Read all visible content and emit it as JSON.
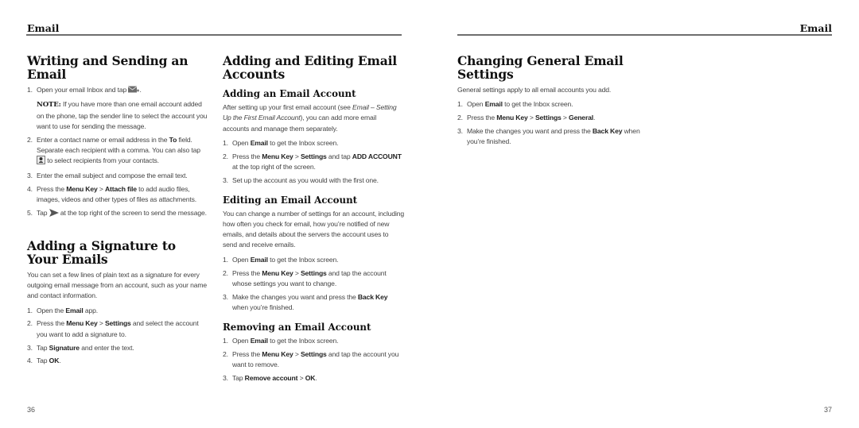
{
  "left_page": {
    "running_head": "Email",
    "page_number": "36",
    "col1": {
      "s1": {
        "title": "Writing and Sending an Email",
        "steps": [
          {
            "n": "1.",
            "a": "Open your email Inbox and tap",
            "b": "."
          },
          {
            "n": "2.",
            "a": "Enter a contact name or email address in the",
            "bold1": "To",
            "b": "field. Separate each recipient with a comma. You can also tap",
            "c": "to select recipients from your contacts."
          },
          {
            "n": "3.",
            "a": "Enter the email subject and compose the email text."
          },
          {
            "n": "4.",
            "a": "Press the",
            "bold1": "Menu Key",
            "sep": ">",
            "bold2": "Attach file",
            "b": "to add audio files, images, videos and other types of files as attachments."
          },
          {
            "n": "5.",
            "a": "Tap",
            "b": "at the top right of the screen to send the message."
          }
        ],
        "note_label": "NOTE:",
        "note_text": "If you have more than one email account added on the phone, tap the sender line to select the account you want to use for sending the message.",
        "icons": {
          "compose": "compose-email-icon",
          "contacts": "contacts-picker-icon",
          "send": "send-icon"
        }
      },
      "s2": {
        "title": "Adding a Signature to Your Emails",
        "intro": "You can set a few lines of plain text as a signature for every outgoing email message from an account, such as your name and contact information.",
        "steps": [
          {
            "n": "1.",
            "a": "Open the",
            "bold1": "Email",
            "b": "app."
          },
          {
            "n": "2.",
            "a": "Press the",
            "bold1": "Menu Key",
            "sep": ">",
            "bold2": "Settings",
            "b": "and select the account you want to add a signature to."
          },
          {
            "n": "3.",
            "a": "Tap",
            "bold1": "Signature",
            "b": "and enter the text."
          },
          {
            "n": "4.",
            "a": "Tap",
            "bold1": "OK",
            "b": "."
          }
        ]
      }
    },
    "col2": {
      "title": "Adding and Editing Email Accounts",
      "sub1": {
        "title": "Adding an Email Account",
        "intro_a": "After setting up your first email account (see",
        "intro_italic": "Email – Setting Up the First Email Account",
        "intro_b": "), you can add more email accounts and manage them separately.",
        "steps": [
          {
            "n": "1.",
            "a": "Open",
            "bold1": "Email",
            "b": "to get the Inbox screen."
          },
          {
            "n": "2.",
            "a": "Press the",
            "bold1": "Menu Key",
            "sep": ">",
            "bold2": "Settings",
            "b": "and tap",
            "bold3": "ADD ACCOUNT",
            "c": "at the top right of the screen."
          },
          {
            "n": "3.",
            "a": "Set up the account as you would with the first one."
          }
        ]
      },
      "sub2": {
        "title": "Editing an Email Account",
        "intro": "You can change a number of settings for an account, including how often you check for email, how you’re notified of new emails, and details about the servers the account uses to send and receive emails.",
        "steps": [
          {
            "n": "1.",
            "a": "Open",
            "bold1": "Email",
            "b": "to get the Inbox screen."
          },
          {
            "n": "2.",
            "a": "Press the",
            "bold1": "Menu Key",
            "sep": ">",
            "bold2": "Settings",
            "b": "and tap the account whose settings you want to change."
          },
          {
            "n": "3.",
            "a": "Make the changes you want and press the",
            "bold1": "Back Key",
            "b": "when you’re finished."
          }
        ]
      },
      "sub3": {
        "title": "Removing an Email Account",
        "steps": [
          {
            "n": "1.",
            "a": "Open",
            "bold1": "Email",
            "b": "to get the Inbox screen."
          },
          {
            "n": "2.",
            "a": "Press the",
            "bold1": "Menu Key",
            "sep": ">",
            "bold2": "Settings",
            "b": "and tap the account you want to remove."
          },
          {
            "n": "3.",
            "a": "Tap",
            "bold1": "Remove account",
            "sep": ">",
            "bold2": "OK",
            "b": "."
          }
        ]
      }
    }
  },
  "right_page": {
    "running_head": "Email",
    "page_number": "37",
    "s1": {
      "title": "Changing General Email Settings",
      "intro": "General settings apply to all email accounts you add.",
      "steps": [
        {
          "n": "1.",
          "a": "Open",
          "bold1": "Email",
          "b": "to get the Inbox screen."
        },
        {
          "n": "2.",
          "a": "Press the",
          "bold1": "Menu Key",
          "sep": ">",
          "bold2": "Settings",
          "sep2": ">",
          "bold3": "General",
          "b": "."
        },
        {
          "n": "3.",
          "a": "Make the changes you want and press the",
          "bold1": "Back Key",
          "b": "when you’re finished."
        }
      ]
    }
  }
}
